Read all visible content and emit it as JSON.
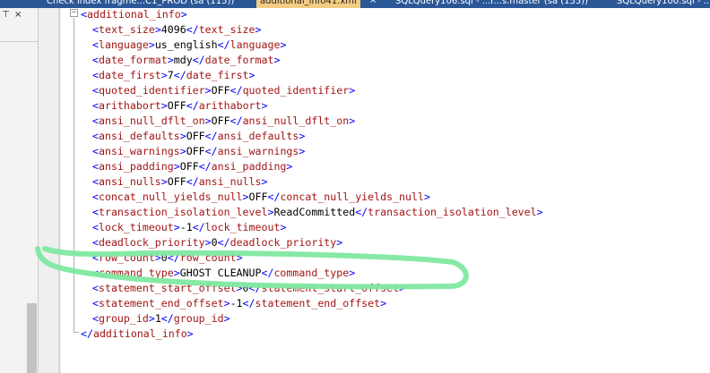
{
  "tabs": [
    {
      "label": "Check index fragme...C1_PROD (sa (115))",
      "active": false
    },
    {
      "label": "additional_info41.xml",
      "active": true
    },
    {
      "label": "SQLQuery106.sql - ...r...s.master (sa (155))",
      "active": false
    },
    {
      "label": "SQLQuery100.sql - ...",
      "active": false
    }
  ],
  "left_panel": {
    "pin_icon": "⊤",
    "close_icon": "×"
  },
  "xml": {
    "root_tag": "additional_info",
    "children": [
      {
        "tag": "text_size",
        "value": "4096"
      },
      {
        "tag": "language",
        "value": "us_english"
      },
      {
        "tag": "date_format",
        "value": "mdy"
      },
      {
        "tag": "date_first",
        "value": "7"
      },
      {
        "tag": "quoted_identifier",
        "value": "OFF"
      },
      {
        "tag": "arithabort",
        "value": "OFF"
      },
      {
        "tag": "ansi_null_dflt_on",
        "value": "OFF"
      },
      {
        "tag": "ansi_defaults",
        "value": "OFF"
      },
      {
        "tag": "ansi_warnings",
        "value": "OFF"
      },
      {
        "tag": "ansi_padding",
        "value": "OFF"
      },
      {
        "tag": "ansi_nulls",
        "value": "OFF"
      },
      {
        "tag": "concat_null_yields_null",
        "value": "OFF"
      },
      {
        "tag": "transaction_isolation_level",
        "value": "ReadCommitted"
      },
      {
        "tag": "lock_timeout",
        "value": "-1"
      },
      {
        "tag": "deadlock_priority",
        "value": "0"
      },
      {
        "tag": "row_count",
        "value": "0"
      },
      {
        "tag": "command_type",
        "value": "GHOST CLEANUP"
      },
      {
        "tag": "statement_start_offset",
        "value": "0"
      },
      {
        "tag": "statement_end_offset",
        "value": "-1"
      },
      {
        "tag": "group_id",
        "value": "1"
      }
    ]
  },
  "colors": {
    "bracket": "#0000ff",
    "tag_name": "#a31515",
    "text": "#000000",
    "highlight_stroke": "#7fe8a0"
  }
}
